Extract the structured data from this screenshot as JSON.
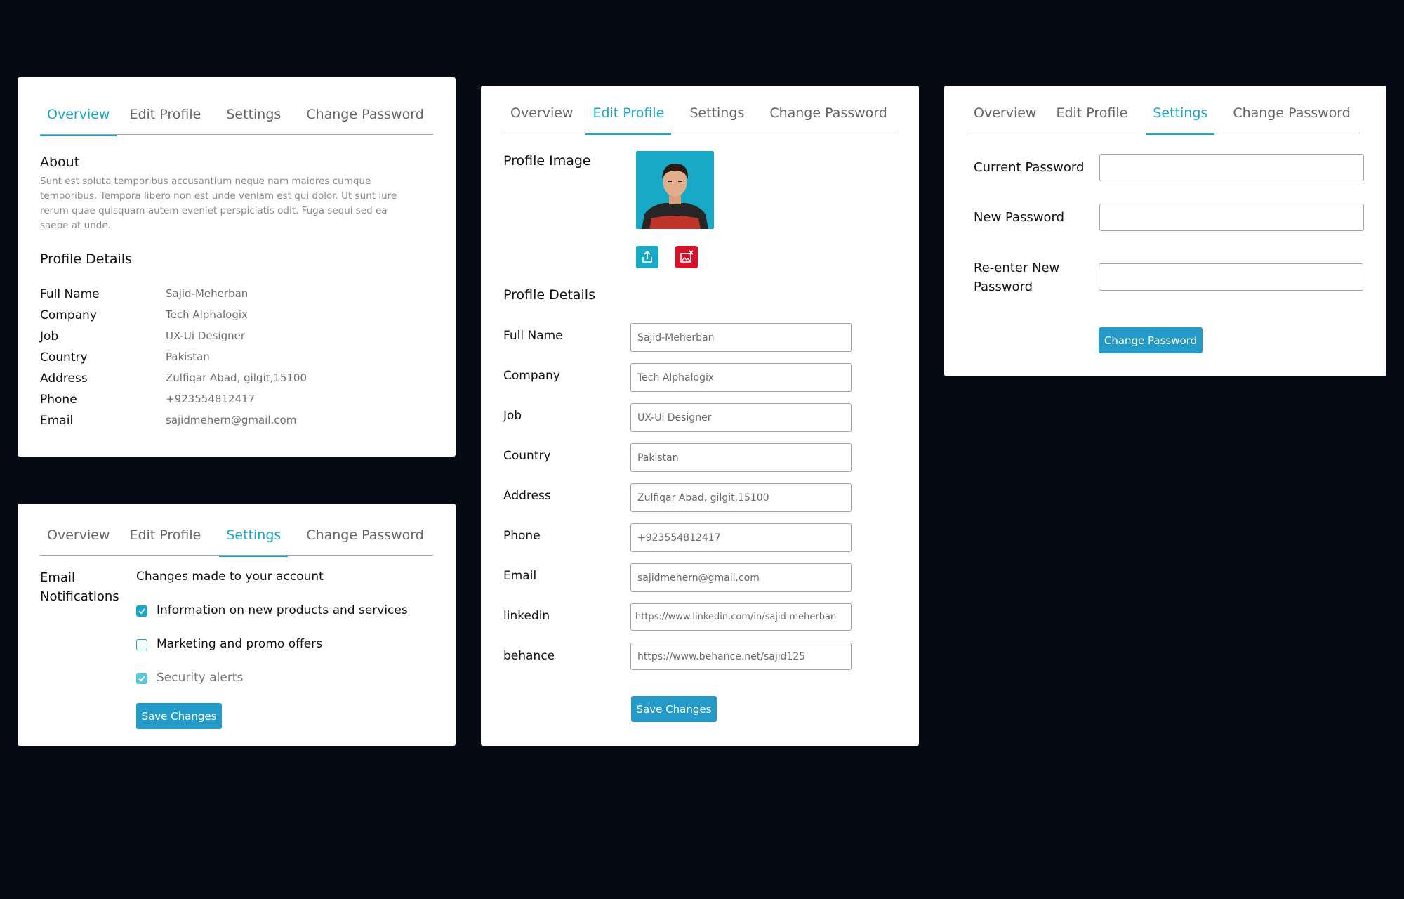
{
  "tabs": {
    "overview": "Overview",
    "edit_profile": "Edit Profile",
    "settings": "Settings",
    "change_password": "Change Password"
  },
  "overview": {
    "about_title": "About",
    "about_text": "Sunt est soluta temporibus accusantium neque nam maiores cumque temporibus. Tempora libero non est unde veniam est qui dolor. Ut sunt iure rerum quae quisquam autem eveniet perspiciatis odit. Fuga sequi sed ea saepe at unde.",
    "details_title": "Profile Details",
    "details": [
      {
        "label": "Full Name",
        "value": "Sajid-Meherban"
      },
      {
        "label": "Company",
        "value": "Tech Alphalogix"
      },
      {
        "label": "Job",
        "value": "UX-Ui Designer"
      },
      {
        "label": "Country",
        "value": "Pakistan"
      },
      {
        "label": "Address",
        "value": "Zulfiqar Abad, gilgit,15100"
      },
      {
        "label": "Phone",
        "value": "+923554812417"
      },
      {
        "label": "Email",
        "value": "sajidmehern@gmail.com"
      }
    ]
  },
  "settings": {
    "email_notifications_label": "Email Notifications",
    "changes_label": "Changes made to your account",
    "options": [
      {
        "label": "Information on new products and services",
        "checked": true
      },
      {
        "label": "Marketing and promo offers",
        "checked": false
      },
      {
        "label": "Security alerts",
        "checked": true
      }
    ],
    "save_label": "Save Changes"
  },
  "edit_profile": {
    "profile_image_label": "Profile Image",
    "details_title": "Profile Details",
    "fields": [
      {
        "label": "Full Name",
        "value": "Sajid-Meherban"
      },
      {
        "label": "Company",
        "value": "Tech Alphalogix"
      },
      {
        "label": "Job",
        "value": "UX-Ui Designer"
      },
      {
        "label": "Country",
        "value": "Pakistan"
      },
      {
        "label": "Address",
        "value": "Zulfiqar Abad, gilgit,15100"
      },
      {
        "label": "Phone",
        "value": "+923554812417"
      },
      {
        "label": "Email",
        "value": "sajidmehern@gmail.com"
      },
      {
        "label": "linkedin",
        "value": "https://www.linkedin.com/in/sajid-meherban"
      },
      {
        "label": "behance",
        "value": "https://www.behance.net/sajid125"
      }
    ],
    "save_label": "Save Changes"
  },
  "change_password": {
    "current_label": "Current Password",
    "new_label": "New Password",
    "reenter_label": "Re-enter New Password",
    "button_label": "Change Password"
  },
  "colors": {
    "accent": "#1aa6c9",
    "button": "#239ac7",
    "danger": "#d8112b",
    "background": "#050a14"
  }
}
